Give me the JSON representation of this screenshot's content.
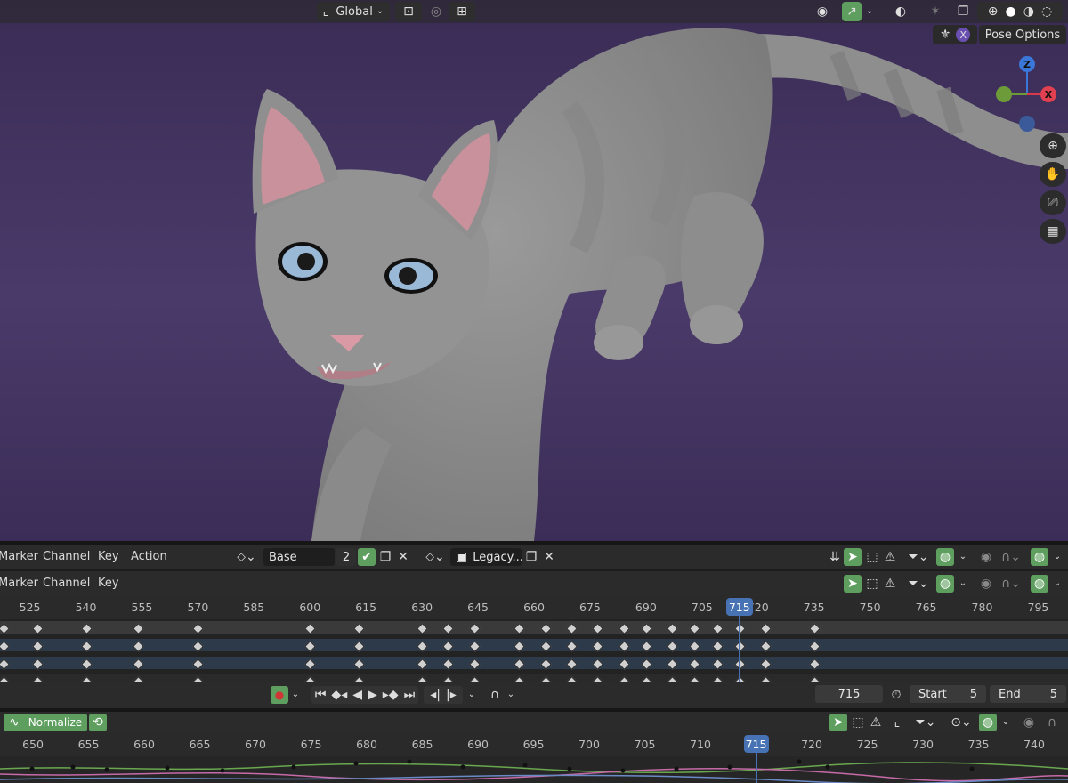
{
  "viewport": {
    "transform_orientation": "Global",
    "pose_options_label": "Pose Options",
    "gizmo": {
      "z": "Z",
      "x": "X"
    }
  },
  "action_editor": {
    "menus": [
      "Marker",
      "Channel",
      "Key",
      "Action"
    ],
    "layer_name": "Base",
    "layer_users": "2",
    "action_name": "Legacy..."
  },
  "dopesheet": {
    "menus": [
      "Marker",
      "Channel",
      "Key"
    ],
    "ruler_ticks": [
      "525",
      "540",
      "555",
      "570",
      "585",
      "600",
      "615",
      "630",
      "645",
      "660",
      "675",
      "690",
      "705",
      "720",
      "735",
      "750",
      "765",
      "780",
      "795"
    ],
    "current_frame_badge": "715",
    "current_frame_value": 715,
    "frame_range": [
      517,
      803
    ]
  },
  "playback": {
    "current_frame": "715",
    "start_label": "Start",
    "start_value": "5",
    "end_label": "End",
    "end_value": "5"
  },
  "graph_editor": {
    "normalize_label": "Normalize",
    "ruler_ticks": [
      "650",
      "655",
      "660",
      "665",
      "670",
      "675",
      "680",
      "685",
      "690",
      "695",
      "700",
      "705",
      "710",
      "715",
      "720",
      "725",
      "730",
      "735",
      "740"
    ],
    "current_frame_badge": "715"
  },
  "colors": {
    "accent": "#4772b3",
    "toggle_green": "#5e9e5e",
    "record_red": "#d03434"
  }
}
